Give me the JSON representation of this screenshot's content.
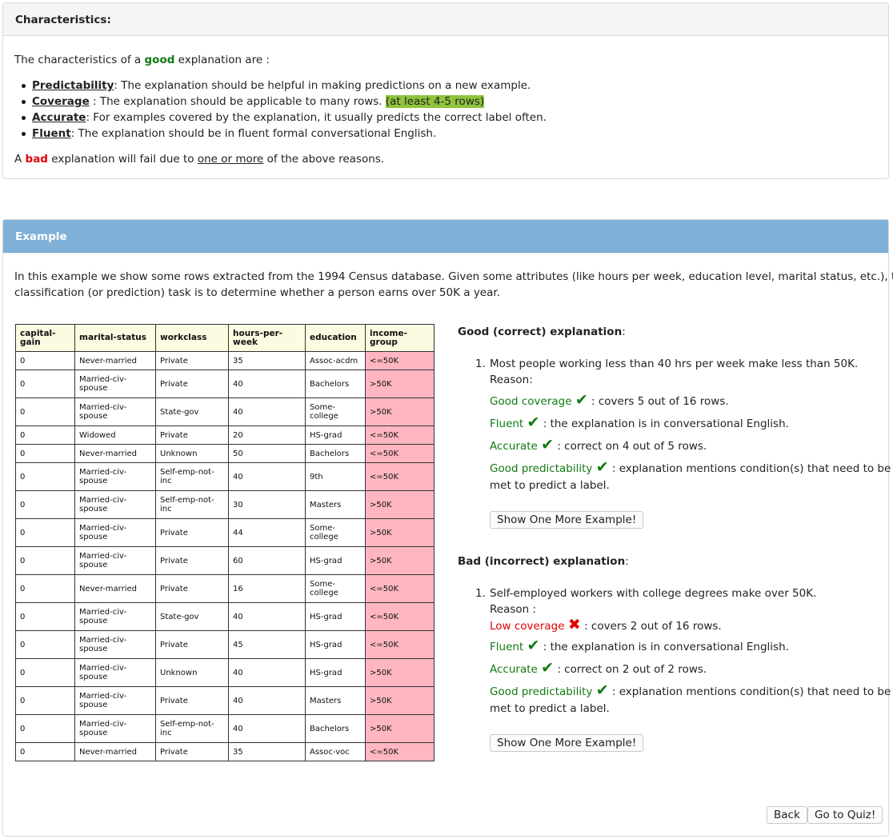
{
  "characteristics": {
    "header": "Characteristics:",
    "intro_pre": "The characteristics of a ",
    "intro_good": "good",
    "intro_post": " explanation are :",
    "items": [
      {
        "term": "Predictability",
        "text": ": The explanation should be helpful in making predictions on a new example."
      },
      {
        "term": "Coverage",
        "text": " : The explanation should be applicable to many rows. ",
        "highlight": "(at least 4-5 rows)"
      },
      {
        "term": "Accurate",
        "text": ": For examples covered by the explanation, it usually predicts the correct label often."
      },
      {
        "term": "Fluent",
        "text": ": The explanation should be in fluent formal conversational English."
      }
    ],
    "outro_pre": "A ",
    "outro_bad": "bad",
    "outro_mid": " explanation will fail due to ",
    "outro_u": "one or more",
    "outro_post": " of the above reasons."
  },
  "example": {
    "header": "Example",
    "intro_line1": "In this example we show some rows extracted from the 1994 Census database. Given some attributes (like hours per week, education level, marital status, etc.), the",
    "intro_line2": "classification (or prediction) task is to determine whether a person earns over 50K a year.",
    "table": {
      "columns": [
        "capital-gain",
        "marital-status",
        "workclass",
        "hours-per-week",
        "education",
        "income-group"
      ],
      "rows": [
        [
          "0",
          "Never-married",
          "Private",
          "35",
          "Assoc-acdm",
          "<=50K"
        ],
        [
          "0",
          "Married-civ-spouse",
          "Private",
          "40",
          "Bachelors",
          ">50K"
        ],
        [
          "0",
          "Married-civ-spouse",
          "State-gov",
          "40",
          "Some-college",
          ">50K"
        ],
        [
          "0",
          "Widowed",
          "Private",
          "20",
          "HS-grad",
          "<=50K"
        ],
        [
          "0",
          "Never-married",
          "Unknown",
          "50",
          "Bachelors",
          "<=50K"
        ],
        [
          "0",
          "Married-civ-spouse",
          "Self-emp-not-inc",
          "40",
          "9th",
          "<=50K"
        ],
        [
          "0",
          "Married-civ-spouse",
          "Self-emp-not-inc",
          "30",
          "Masters",
          ">50K"
        ],
        [
          "0",
          "Married-civ-spouse",
          "Private",
          "44",
          "Some-college",
          ">50K"
        ],
        [
          "0",
          "Married-civ-spouse",
          "Private",
          "60",
          "HS-grad",
          ">50K"
        ],
        [
          "0",
          "Never-married",
          "Private",
          "16",
          "Some-college",
          "<=50K"
        ],
        [
          "0",
          "Married-civ-spouse",
          "State-gov",
          "40",
          "HS-grad",
          "<=50K"
        ],
        [
          "0",
          "Married-civ-spouse",
          "Private",
          "45",
          "HS-grad",
          "<=50K"
        ],
        [
          "0",
          "Married-civ-spouse",
          "Unknown",
          "40",
          "HS-grad",
          ">50K"
        ],
        [
          "0",
          "Married-civ-spouse",
          "Private",
          "40",
          "Masters",
          ">50K"
        ],
        [
          "0",
          "Married-civ-spouse",
          "Self-emp-not-inc",
          "40",
          "Bachelors",
          ">50K"
        ],
        [
          "0",
          "Never-married",
          "Private",
          "35",
          "Assoc-voc",
          "<=50K"
        ]
      ]
    },
    "good": {
      "title": "Good (correct) explanation",
      "colon": ":",
      "number": "1.",
      "statement": "Most people working less than 40 hrs per week make less than 50K.",
      "reason": "Reason:",
      "criteria": [
        {
          "label": "Good coverage",
          "mark": "✔",
          "text": " : covers 5 out of 16 rows."
        },
        {
          "label": "Fluent",
          "mark": "✔",
          "text": " : the explanation is in conversational English."
        },
        {
          "label": "Accurate",
          "mark": "✔",
          "text": " : correct on 4 out of 5 rows."
        },
        {
          "label": "Good predictability",
          "mark": "✔",
          "text": " : explanation mentions condition(s) that need to be"
        }
      ],
      "continuation": "met to predict a label.",
      "button": "Show One More Example!"
    },
    "bad": {
      "title": "Bad (incorrect) explanation",
      "colon": ":",
      "number": "1.",
      "statement": "Self-employed workers with college degrees make over 50K.",
      "reason": "Reason :",
      "criteria": [
        {
          "label": "Low coverage",
          "mark": "✖",
          "text": " : covers 2 out of 16 rows."
        },
        {
          "label": "Fluent",
          "mark": "✔",
          "text": " : the explanation is in conversational English."
        },
        {
          "label": "Accurate",
          "mark": "✔",
          "text": " : correct on 2 out of 2 rows."
        },
        {
          "label": "Good predictability",
          "mark": "✔",
          "text": " : explanation mentions condition(s) that need to be"
        }
      ],
      "continuation": "met to predict a label.",
      "button": "Show One More Example!"
    },
    "nav": {
      "back": "Back",
      "quiz": "Go to Quiz!"
    }
  }
}
